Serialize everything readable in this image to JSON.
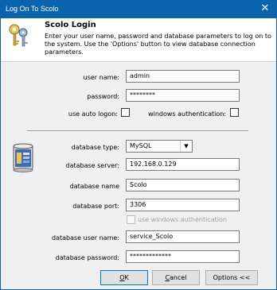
{
  "window": {
    "title": "Log On To Scolo",
    "close_glyph": "✕"
  },
  "header": {
    "title": "Scolo Login",
    "description": "Enter your user name, password and database parameters to log on to the system.  Use the 'Options' button to view database connection parameters.",
    "icon": "keys-icon"
  },
  "login": {
    "username_label": "user name:",
    "username_value": "admin",
    "password_label": "password:",
    "password_value": "********",
    "auto_logon_label": "use auto logon:",
    "auto_logon_checked": false,
    "windows_auth_label": "windows authentication:",
    "windows_auth_checked": false
  },
  "database": {
    "icon": "database-icon",
    "type_label": "database type:",
    "type_value": "MySQL",
    "server_label": "database server:",
    "server_value": "192.168.0.129",
    "name_label": "database name",
    "name_value": "Scolo",
    "port_label": "database port:",
    "port_value": "3306",
    "use_windows_auth_label": "use windows authentication",
    "use_windows_auth_checked": false,
    "user_label": "database user name:",
    "user_value": "service_Scolo",
    "password_label": "database password:",
    "password_value": "*************"
  },
  "buttons": {
    "ok_underlined": "O",
    "ok_rest": "K",
    "cancel_underlined": "C",
    "cancel_rest": "ancel",
    "options": "Options <<"
  },
  "colors": {
    "titlebar": "#0a64ad",
    "dialog_bg": "#f0f0f0",
    "header_bg": "#ffffff"
  }
}
